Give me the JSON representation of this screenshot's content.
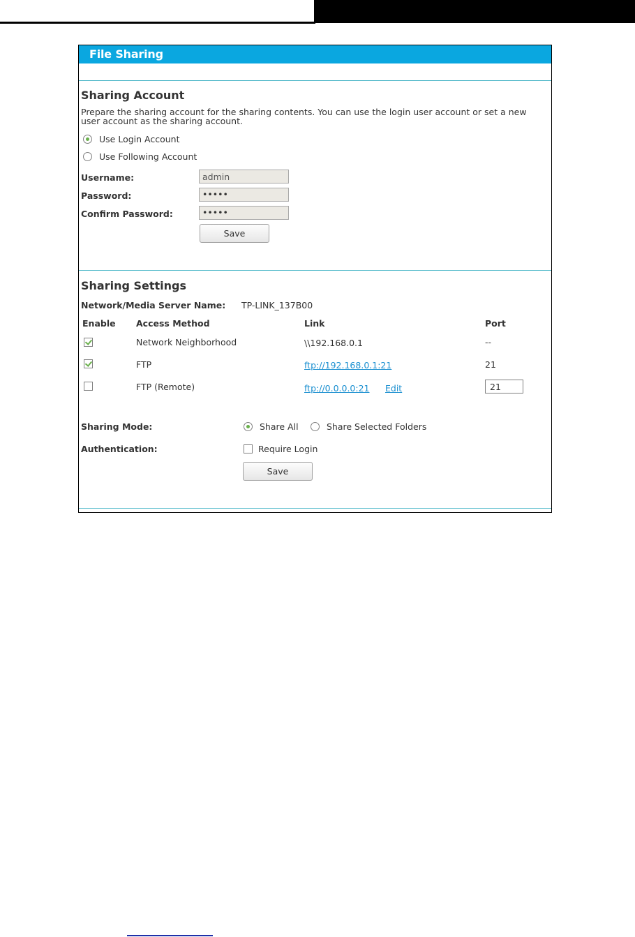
{
  "page": {
    "title": "File Sharing"
  },
  "account": {
    "heading": "Sharing Account",
    "description": "Prepare the sharing account for the sharing contents. You can use the login user account or set a new user account as the sharing account.",
    "options": [
      {
        "label": "Use Login Account",
        "selected": true
      },
      {
        "label": "Use Following Account",
        "selected": false
      }
    ],
    "username_label": "Username:",
    "username_value": "admin",
    "password_label": "Password:",
    "password_value": "•••••",
    "confirm_label": "Confirm Password:",
    "confirm_value": "•••••",
    "save_label": "Save"
  },
  "settings": {
    "heading": "Sharing Settings",
    "server_name_label": "Network/Media Server Name:",
    "server_name_value": "TP-LINK_137B00",
    "columns": [
      "Enable",
      "Access Method",
      "Link",
      "Port"
    ],
    "rows": [
      {
        "enabled": true,
        "method": "Network Neighborhood",
        "link": "\\\\192.168.0.1",
        "link_is_url": false,
        "port": "--"
      },
      {
        "enabled": true,
        "method": "FTP",
        "link": "ftp://192.168.0.1:21",
        "link_is_url": true,
        "port": "21"
      },
      {
        "enabled": false,
        "method": "FTP (Remote)",
        "link": "ftp://0.0.0.0:21",
        "link_is_url": true,
        "edit_label": "Edit",
        "port": "21"
      }
    ],
    "sharing_mode_label": "Sharing Mode:",
    "sharing_mode_options": [
      {
        "label": "Share All",
        "selected": true
      },
      {
        "label": "Share Selected Folders",
        "selected": false
      }
    ],
    "authentication_label": "Authentication:",
    "require_login_label": "Require Login",
    "require_login_checked": false,
    "save_label": "Save"
  },
  "colors": {
    "accent": "#0aa7e0",
    "divider": "#4fb8c9",
    "link": "#1a8fd0",
    "check": "#6ab04c"
  }
}
